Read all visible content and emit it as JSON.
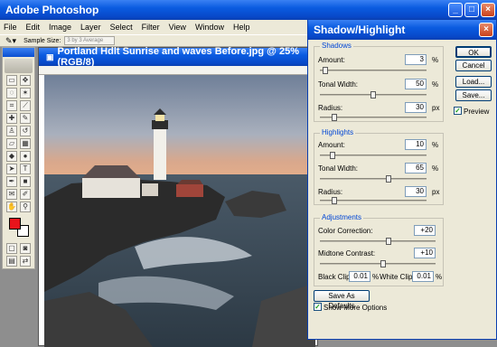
{
  "app": {
    "title": "Adobe Photoshop",
    "menu": [
      "File",
      "Edit",
      "Image",
      "Layer",
      "Select",
      "Filter",
      "View",
      "Window",
      "Help"
    ]
  },
  "options_bar": {
    "sample_size_label": "Sample Size:",
    "sample_size_value": "3 by 3 Average"
  },
  "document": {
    "title": "Portland Hdlt Sunrise and waves Before.jpg @ 25% (RGB/8)"
  },
  "dialog": {
    "title": "Shadow/Highlight",
    "shadows": {
      "title": "Shadows",
      "amount_label": "Amount:",
      "amount": "3",
      "amount_unit": "%",
      "amount_pos": 0.03,
      "tonal_label": "Tonal Width:",
      "tonal": "50",
      "tonal_unit": "%",
      "tonal_pos": 0.5,
      "radius_label": "Radius:",
      "radius": "30",
      "radius_unit": "px",
      "radius_pos": 0.12
    },
    "highlights": {
      "title": "Highlights",
      "amount_label": "Amount:",
      "amount": "10",
      "amount_unit": "%",
      "amount_pos": 0.1,
      "tonal_label": "Tonal Width:",
      "tonal": "65",
      "tonal_unit": "%",
      "tonal_pos": 0.65,
      "radius_label": "Radius:",
      "radius": "30",
      "radius_unit": "px",
      "radius_pos": 0.12
    },
    "adjustments": {
      "title": "Adjustments",
      "color_label": "Color Correction:",
      "color": "+20",
      "color_pos": 0.6,
      "midtone_label": "Midtone Contrast:",
      "midtone": "+10",
      "midtone_pos": 0.55,
      "black_clip_label": "Black Clip:",
      "black_clip": "0.01",
      "black_clip_unit": "%",
      "white_clip_label": "White Clip:",
      "white_clip": "0.01",
      "white_clip_unit": "%"
    },
    "buttons": {
      "ok": "OK",
      "cancel": "Cancel",
      "load": "Load...",
      "save": "Save...",
      "save_defaults": "Save As Defaults"
    },
    "preview_label": "Preview",
    "show_more_label": "Show More Options"
  }
}
